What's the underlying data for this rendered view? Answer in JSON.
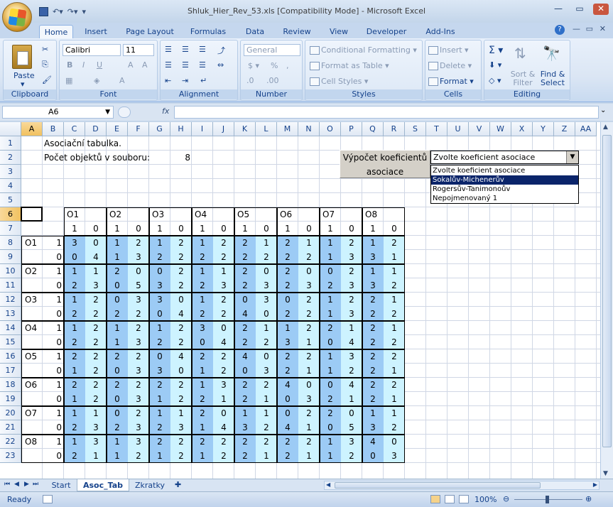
{
  "window": {
    "title": "Shluk_Hier_Rev_53.xls  [Compatibility Mode] - Microsoft Excel"
  },
  "tabs": [
    "Home",
    "Insert",
    "Page Layout",
    "Formulas",
    "Data",
    "Review",
    "View",
    "Developer",
    "Add-Ins"
  ],
  "ribbon": {
    "clipboard": {
      "label": "Clipboard",
      "paste": "Paste"
    },
    "font": {
      "label": "Font",
      "name": "Calibri",
      "size": "11"
    },
    "alignment": {
      "label": "Alignment"
    },
    "number": {
      "label": "Number",
      "format": "General"
    },
    "styles": {
      "label": "Styles",
      "conditional": "Conditional Formatting",
      "format_table": "Format as Table",
      "cell_styles": "Cell Styles"
    },
    "cells": {
      "label": "Cells",
      "insert": "Insert",
      "delete": "Delete",
      "format": "Format"
    },
    "editing": {
      "label": "Editing",
      "sort": "Sort & Filter",
      "find": "Find & Select"
    }
  },
  "formula_bar": {
    "name_box": "A6",
    "fx": "fx",
    "formula": ""
  },
  "columns": [
    "A",
    "B",
    "C",
    "D",
    "E",
    "F",
    "G",
    "H",
    "I",
    "J",
    "K",
    "L",
    "M",
    "N",
    "O",
    "P",
    "Q",
    "R",
    "S",
    "T",
    "U",
    "V",
    "W",
    "X",
    "Y",
    "Z",
    "AA"
  ],
  "rows": [
    "1",
    "2",
    "3",
    "4",
    "5",
    "6",
    "7",
    "8",
    "9",
    "10",
    "11",
    "12",
    "13",
    "14",
    "15",
    "16",
    "17",
    "18",
    "19",
    "20",
    "21",
    "22",
    "23"
  ],
  "sheet": {
    "title": "Asociační tabulka.",
    "count_label": "Počet objektů v souboru:",
    "count_value": "8",
    "button_label_1": "Výpočet koeficientů",
    "button_label_2": "asociace",
    "combo_value": "Zvolte koeficient asociace",
    "combo_options": [
      "Zvolte koeficient asociace",
      "Sokalův-Michenerův",
      "Rogersův-Tanimonoův",
      "Nepojmenovaný 1"
    ],
    "combo_selected_index": 1,
    "objects": [
      "O1",
      "O2",
      "O3",
      "O4",
      "O5",
      "O6",
      "O7",
      "O8"
    ],
    "binary": [
      "1",
      "0"
    ],
    "matrix": [
      [
        3,
        0,
        1,
        2,
        1,
        2,
        1,
        2,
        2,
        1,
        2,
        1,
        1,
        2,
        1,
        2
      ],
      [
        0,
        4,
        1,
        3,
        2,
        2,
        2,
        2,
        2,
        2,
        2,
        2,
        1,
        3,
        3,
        1
      ],
      [
        1,
        1,
        2,
        0,
        0,
        2,
        1,
        1,
        2,
        0,
        2,
        0,
        0,
        2,
        1,
        1
      ],
      [
        2,
        3,
        0,
        5,
        3,
        2,
        2,
        3,
        2,
        3,
        2,
        3,
        2,
        3,
        3,
        2
      ],
      [
        1,
        2,
        0,
        3,
        3,
        0,
        1,
        2,
        0,
        3,
        0,
        2,
        1,
        2,
        2,
        1
      ],
      [
        2,
        2,
        2,
        2,
        0,
        4,
        2,
        2,
        4,
        0,
        2,
        2,
        1,
        3,
        2,
        2
      ],
      [
        1,
        2,
        1,
        2,
        1,
        2,
        3,
        0,
        2,
        1,
        1,
        2,
        2,
        1,
        2,
        1
      ],
      [
        2,
        2,
        1,
        3,
        2,
        2,
        0,
        4,
        2,
        2,
        3,
        1,
        0,
        4,
        2,
        2
      ],
      [
        2,
        2,
        2,
        2,
        0,
        4,
        2,
        2,
        4,
        0,
        2,
        2,
        1,
        3,
        2,
        2
      ],
      [
        1,
        2,
        0,
        3,
        3,
        0,
        1,
        2,
        0,
        3,
        2,
        1,
        1,
        2,
        2,
        1
      ],
      [
        2,
        2,
        2,
        2,
        2,
        2,
        1,
        3,
        2,
        2,
        4,
        0,
        0,
        4,
        2,
        2
      ],
      [
        1,
        2,
        0,
        3,
        1,
        2,
        2,
        1,
        2,
        1,
        0,
        3,
        2,
        1,
        2,
        1
      ],
      [
        1,
        1,
        0,
        2,
        1,
        1,
        2,
        0,
        1,
        1,
        0,
        2,
        2,
        0,
        1,
        1
      ],
      [
        2,
        3,
        2,
        3,
        2,
        3,
        1,
        4,
        3,
        2,
        4,
        1,
        0,
        5,
        3,
        2
      ],
      [
        1,
        3,
        1,
        3,
        2,
        2,
        2,
        2,
        2,
        2,
        2,
        2,
        1,
        3,
        4,
        0
      ],
      [
        2,
        1,
        1,
        2,
        1,
        2,
        1,
        2,
        2,
        1,
        2,
        1,
        1,
        2,
        0,
        3
      ]
    ]
  },
  "sheet_tabs": [
    "Start",
    "Asoc_Tab",
    "Zkratky"
  ],
  "active_sheet": "Asoc_Tab",
  "status": {
    "ready": "Ready",
    "zoom": "100%"
  }
}
